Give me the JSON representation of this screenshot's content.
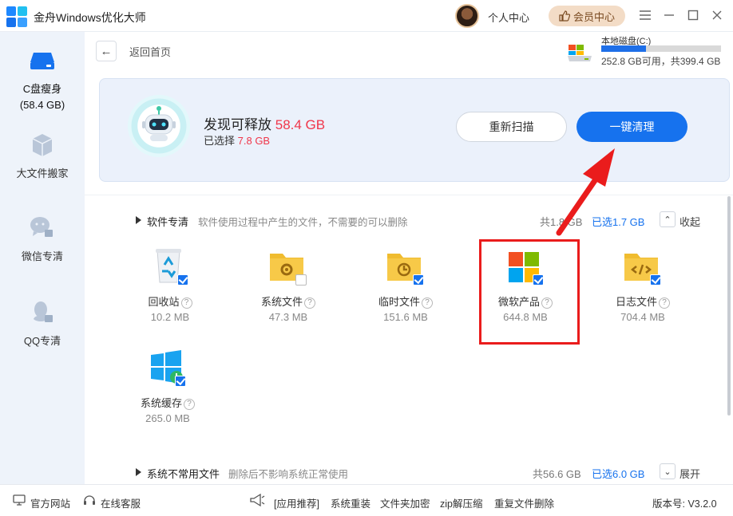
{
  "app": {
    "title": "金舟Windows优化大师"
  },
  "header": {
    "user_center": "个人中心",
    "vip_label": "会员中心"
  },
  "sidebar": {
    "items": [
      {
        "label": "C盘瘦身",
        "sub": "(58.4 GB)"
      },
      {
        "label": "大文件搬家"
      },
      {
        "label": "微信专清"
      },
      {
        "label": "QQ专清"
      }
    ]
  },
  "nav": {
    "back_label": "返回首页"
  },
  "disk": {
    "name": "本地磁盘(C:)",
    "info": "252.8 GB可用，共399.4 GB",
    "used_fraction": 0.37
  },
  "scan": {
    "found_label": "发现可释放",
    "found_size": "58.4 GB",
    "selected_label": "已选择",
    "selected_size": "7.8 GB",
    "rescan_label": "重新扫描",
    "clean_label": "一键清理"
  },
  "sections": [
    {
      "title": "软件专清",
      "desc": "软件使用过程中产生的文件，不需要的可以删除",
      "total": "共1.8 GB",
      "selected": "已选1.7 GB",
      "toggle": "收起",
      "items": [
        {
          "name": "回收站",
          "size": "10.2 MB",
          "checked": true,
          "icon": "recycle-bin-icon"
        },
        {
          "name": "系统文件",
          "size": "47.3 MB",
          "checked": false,
          "icon": "system-folder-icon"
        },
        {
          "name": "临时文件",
          "size": "151.6 MB",
          "checked": true,
          "icon": "temp-folder-icon"
        },
        {
          "name": "微软产品",
          "size": "644.8 MB",
          "checked": true,
          "icon": "microsoft-icon"
        },
        {
          "name": "日志文件",
          "size": "704.4 MB",
          "checked": true,
          "icon": "code-folder-icon"
        },
        {
          "name": "系统缓存",
          "size": "265.0 MB",
          "checked": true,
          "icon": "windows-cache-icon"
        }
      ]
    },
    {
      "title": "系统不常用文件",
      "desc": "删除后不影响系统正常使用",
      "total": "共56.6 GB",
      "selected": "已选6.0 GB",
      "toggle": "展开"
    }
  ],
  "footer": {
    "website": "官方网站",
    "support": "在线客服",
    "recommend": "[应用推荐]",
    "links": [
      "系统重装",
      "文件夹加密",
      "zip解压缩",
      "重复文件删除"
    ],
    "version": "版本号: V3.2.0"
  },
  "colors": {
    "accent": "#1672ee",
    "highlight": "#f0364a",
    "annotation": "#ea1c1c"
  }
}
